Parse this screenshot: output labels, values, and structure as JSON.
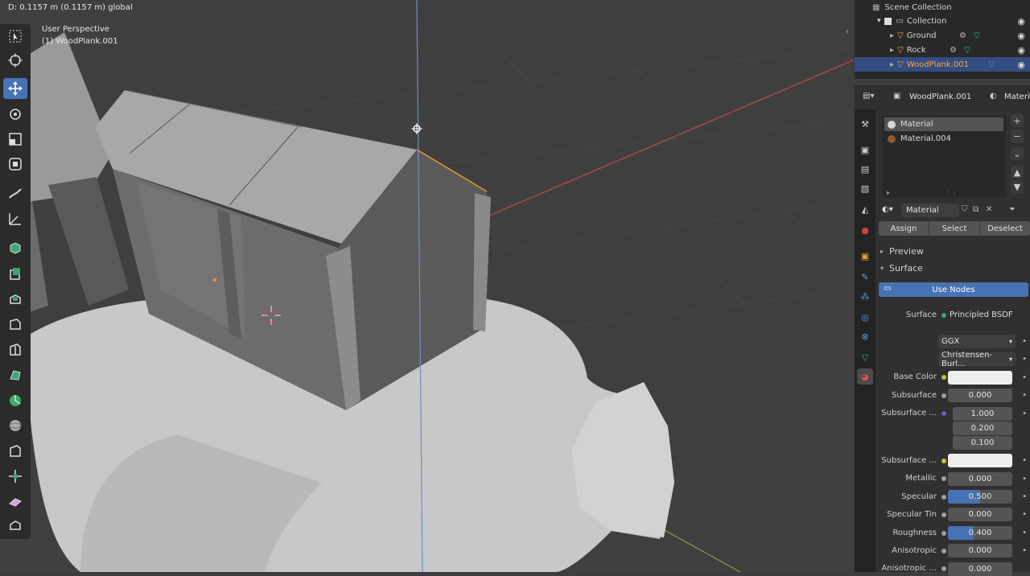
{
  "viewport": {
    "status": "D: 0.1157 m (0.1157 m) global",
    "perspective": "User Perspective",
    "object": "(1) WoodPlank.001"
  },
  "outliner": {
    "title": "Scene Collection",
    "collection": "Collection",
    "items": [
      {
        "label": "Ground"
      },
      {
        "label": "Rock"
      },
      {
        "label": "WoodPlank.001"
      }
    ]
  },
  "properties": {
    "object_name": "WoodPlank.001",
    "header_right": "Materi",
    "slots": [
      {
        "label": "Material",
        "color": "#d8d8d8"
      },
      {
        "label": "Material.004",
        "color": "#8a5a38"
      }
    ],
    "material_name": "Material",
    "buttons": {
      "assign": "Assign",
      "select": "Select",
      "deselect": "Deselect"
    },
    "sections": {
      "preview": "Preview",
      "surface": "Surface"
    },
    "use_nodes": "Use Nodes",
    "surface_label": "Surface",
    "surface_value": "Principled BSDF",
    "distribution": "GGX",
    "subsurface_method": "Christensen-Burl...",
    "params": {
      "base_color": "Base Color",
      "subsurface": "Subsurface",
      "subsurface_value": "0.000",
      "subsurface_radius": "Subsurface ...",
      "radius_values": [
        "1.000",
        "0.200",
        "0.100"
      ],
      "subsurface_color": "Subsurface ...",
      "metallic": "Metallic",
      "metallic_value": "0.000",
      "specular": "Specular",
      "specular_value": "0.500",
      "specular_tint": "Specular Tin",
      "specular_tint_value": "0.000",
      "roughness": "Roughness",
      "roughness_value": "0.400",
      "anisotropic": "Anisotropic",
      "anisotropic_value": "0.000",
      "anisotropic_rot": "Anisotropic ...",
      "anisotropic_rot_value": "0.000"
    },
    "specular_fraction": 0.5,
    "roughness_fraction": 0.4
  },
  "colors": {
    "accent": "#4772b3",
    "selected_text": "#ffa540"
  }
}
